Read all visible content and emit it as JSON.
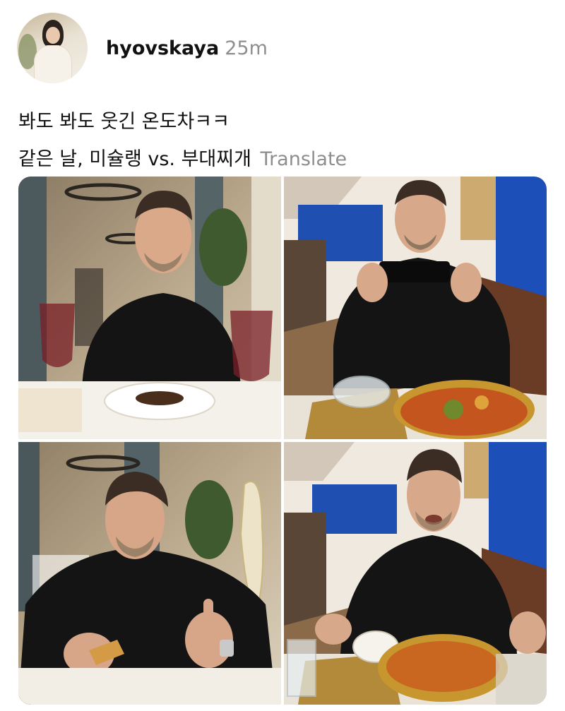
{
  "post": {
    "username": "hyovskaya",
    "timestamp": "25m",
    "caption_line1": "봐도 봐도 웃긴 온도차ㅋㅋ",
    "caption_line2": "같은 날, 미슐랭 vs. 부대찌개",
    "translate_label": "Translate"
  },
  "photos": [
    {
      "icon": "photo-fine-dining-smiling"
    },
    {
      "icon": "photo-budae-jjigae-taking-picture"
    },
    {
      "icon": "photo-fine-dining-thumbs-up"
    },
    {
      "icon": "photo-budae-jjigae-eating"
    }
  ],
  "colors": {
    "text": "#111111",
    "muted": "#8e8e8e",
    "background": "#ffffff"
  }
}
